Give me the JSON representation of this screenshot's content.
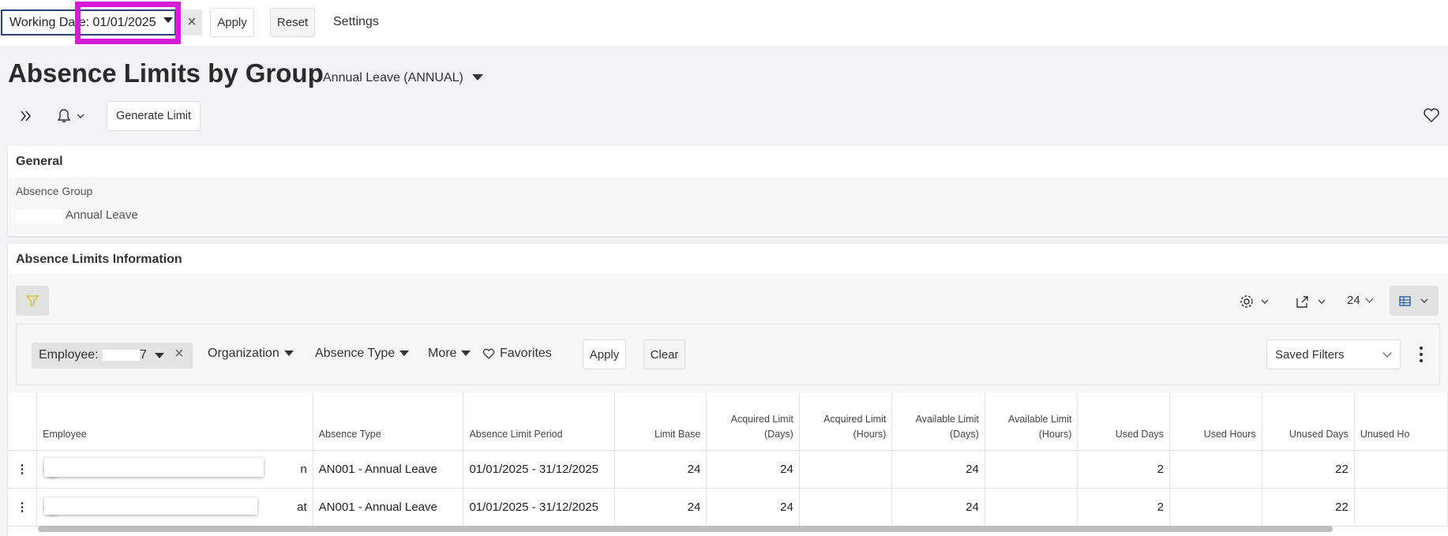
{
  "topbar": {
    "working_date_label": "Working Date: 01/01/2025",
    "apply_label": "Apply",
    "reset_label": "Reset",
    "settings_label": "Settings"
  },
  "page": {
    "title": "Absence Limits by Group",
    "subtitle": "Annual Leave (ANNUAL)"
  },
  "toolbar": {
    "generate_limit_label": "Generate Limit"
  },
  "general": {
    "heading": "General",
    "absence_group_label": "Absence Group",
    "absence_group_value": "Annual Leave"
  },
  "info": {
    "heading": "Absence Limits Information",
    "page_size": "24",
    "filters": {
      "employee_chip": "Employee:",
      "employee_chip_value_tail": "7",
      "organization": "Organization",
      "absence_type": "Absence Type",
      "more": "More",
      "favorites": "Favorites",
      "apply": "Apply",
      "clear": "Clear",
      "saved_filters": "Saved Filters"
    },
    "columns": [
      "Employee",
      "Absence Type",
      "Absence Limit Period",
      "Limit Base",
      "Acquired Limit (Days)",
      "Acquired Limit (Hours)",
      "Available Limit (Days)",
      "Available Limit (Hours)",
      "Used Days",
      "Used Hours",
      "Unused Days",
      "Unused Ho"
    ],
    "rows": [
      {
        "employee_tail": "n",
        "absence_type": "AN001 - Annual Leave",
        "period": "01/01/2025 - 31/12/2025",
        "limit_base": "24",
        "acq_days": "24",
        "acq_hours": "",
        "avail_days": "24",
        "avail_hours": "",
        "used_days": "2",
        "used_hours": "",
        "unused_days": "22",
        "unused_hours": ""
      },
      {
        "employee_tail": "at",
        "absence_type": "AN001 - Annual Leave",
        "period": "01/01/2025 - 31/12/2025",
        "limit_base": "24",
        "acq_days": "24",
        "acq_hours": "",
        "avail_days": "24",
        "avail_hours": "",
        "used_days": "2",
        "used_hours": "",
        "unused_days": "22",
        "unused_hours": ""
      }
    ]
  },
  "colors": {
    "highlight": "#d51bd5",
    "link": "#1f6ab5",
    "field_border": "#2b3f7a",
    "filter_icon": "#d8c43a"
  }
}
